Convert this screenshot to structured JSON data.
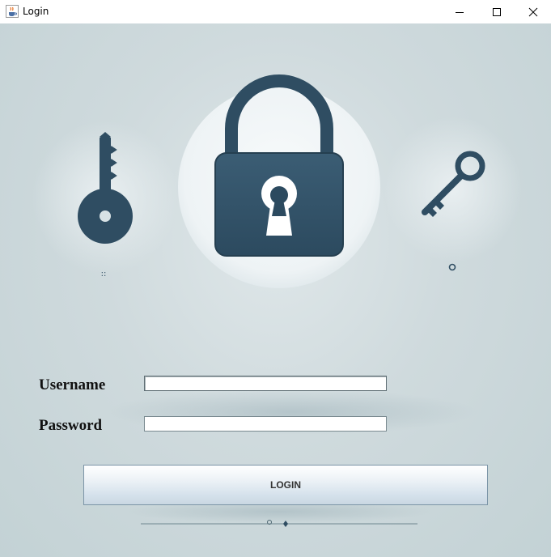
{
  "window": {
    "title": "Login",
    "app_icon": "java-cup-icon",
    "controls": [
      "minimize-icon",
      "maximize-icon",
      "close-icon"
    ]
  },
  "illustration": {
    "elements": [
      "key-left-icon",
      "padlock-icon",
      "key-right-icon"
    ],
    "colors": {
      "lock_body": "#34546a",
      "lock_circle": "#f1f5f6",
      "background": "#cfdadd"
    }
  },
  "form": {
    "username_label": "Username",
    "username_value": "",
    "password_label": "Password",
    "password_value": "",
    "login_label": "LOGIN"
  }
}
